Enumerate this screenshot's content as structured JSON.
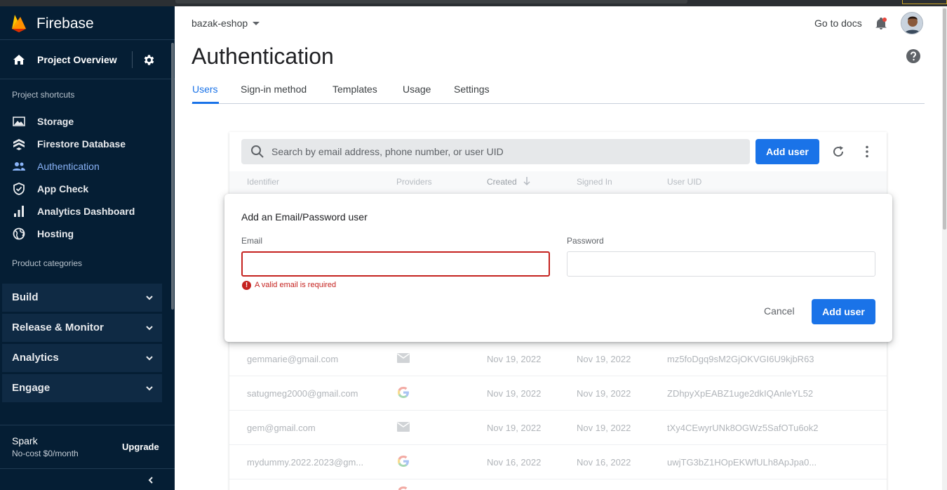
{
  "app": {
    "name": "Firebase"
  },
  "sidebar": {
    "overview_label": "Project Overview",
    "shortcuts_heading": "Project shortcuts",
    "shortcuts": [
      {
        "label": "Storage",
        "icon": "image-icon"
      },
      {
        "label": "Firestore Database",
        "icon": "firestore-icon"
      },
      {
        "label": "Authentication",
        "icon": "people-icon"
      },
      {
        "label": "App Check",
        "icon": "shield-icon"
      },
      {
        "label": "Analytics Dashboard",
        "icon": "bar-chart-icon"
      },
      {
        "label": "Hosting",
        "icon": "globe-icon"
      }
    ],
    "categories_heading": "Product categories",
    "categories": [
      "Build",
      "Release & Monitor",
      "Analytics",
      "Engage"
    ],
    "plan": {
      "name": "Spark",
      "description": "No-cost $0/month",
      "upgrade_label": "Upgrade"
    }
  },
  "header": {
    "project": "bazak-eshop",
    "docs_link": "Go to docs",
    "title": "Authentication"
  },
  "tabs": [
    "Users",
    "Sign-in method",
    "Templates",
    "Usage",
    "Settings"
  ],
  "users": {
    "search_placeholder": "Search by email address, phone number, or user UID",
    "add_user_label": "Add user",
    "columns": [
      "Identifier",
      "Providers",
      "Created",
      "Signed In",
      "User UID"
    ],
    "rows": [
      {
        "identifier": "gemmarie@gmail.com",
        "provider": "email",
        "created": "Nov 19, 2022",
        "signed_in": "Nov 19, 2022",
        "uid": "mz5foDgq9sM2GjOKVGI6U9kjbR63"
      },
      {
        "identifier": "satugmeg2000@gmail.com",
        "provider": "google",
        "created": "Nov 19, 2022",
        "signed_in": "Nov 19, 2022",
        "uid": "ZDhpyXpEABZ1uge2dkIQAnleYL52"
      },
      {
        "identifier": "gem@gmail.com",
        "provider": "email",
        "created": "Nov 19, 2022",
        "signed_in": "Nov 19, 2022",
        "uid": "tXy4CEwyrUNk8OGWz5SafOTu6ok2"
      },
      {
        "identifier": "mydummy.2022.2023@gm...",
        "provider": "google",
        "created": "Nov 16, 2022",
        "signed_in": "Nov 16, 2022",
        "uid": "uwjTG3bZ1HOpEKWfULh8ApJpa0..."
      }
    ]
  },
  "dialog": {
    "title": "Add an Email/Password user",
    "email_label": "Email",
    "email_value": "",
    "password_label": "Password",
    "password_value": "",
    "error_text": "A valid email is required",
    "cancel_label": "Cancel",
    "submit_label": "Add user"
  },
  "colors": {
    "sidebar_bg": "#051e34",
    "accent": "#1a73e8",
    "error": "#c5221f"
  }
}
